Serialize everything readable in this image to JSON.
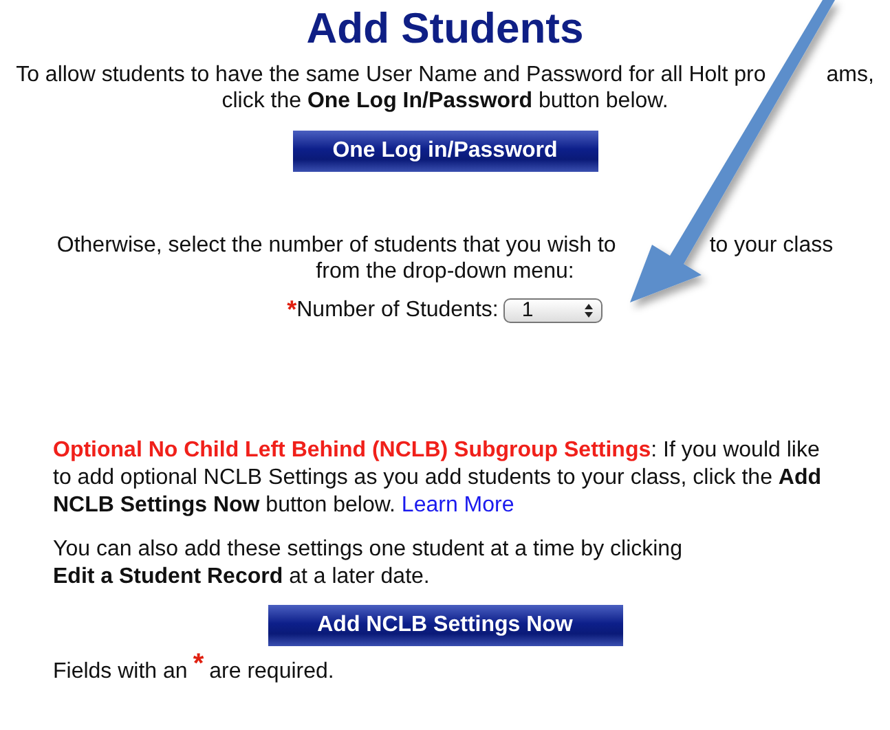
{
  "title": "Add Students",
  "intro": {
    "line_start": "To allow students to have the same User Name and Password for all Holt pro",
    "line_end": "ams,",
    "line2": "click the **One Log In/Password** button below.",
    "button": "One Log in/Password"
  },
  "otherwise": {
    "line_start": "Otherwise, select the number of students that you wish to",
    "line_end": "to your class",
    "line2": "from the drop-down menu:",
    "required_mark": "*",
    "label": "Number of Students:",
    "value": "1"
  },
  "nclb": {
    "text": "**Optional No Child Left Behind (NCLB) Subgroup Settings**: If you would like to add optional NCLB Settings as you add students to your class, click the **Add NCLB Settings Now** button below.",
    "link": "Learn More",
    "note_lines": [
      "You can also add these settings one student at a time by clicking",
      "**Edit a Student Record** at a later date."
    ],
    "button": "Add NCLB Settings Now"
  },
  "footer": {
    "before": "Fields with an",
    "mark": "*",
    "after": "are required."
  }
}
